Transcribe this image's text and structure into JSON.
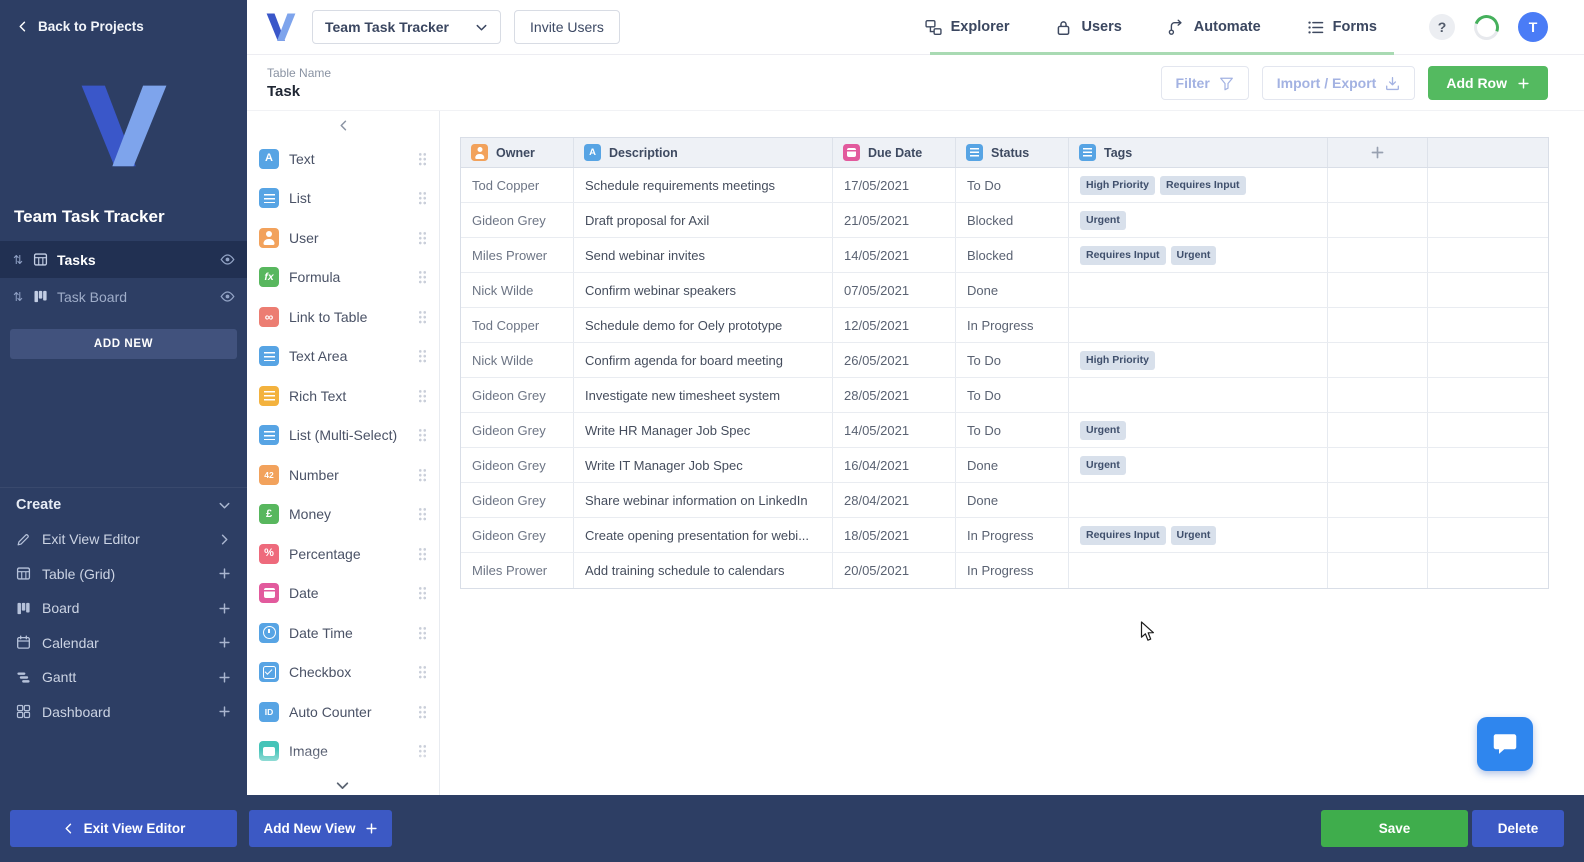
{
  "colors": {
    "sidebar_bg": "#2d3e64",
    "primary_blue": "#3c59c4",
    "save_green": "#3fad4c",
    "add_row_green": "#54ba60",
    "active_tab_underline": "#a9dab3",
    "tag_bg": "#d8e0eb",
    "tag_text": "#3f4f6c",
    "chat_blue": "#2f86ee",
    "avatar_blue": "#4a7cf6"
  },
  "topnav": {
    "workspace_dropdown": "Team Task Tracker",
    "invite_button": "Invite Users",
    "items": [
      {
        "label": "Explorer",
        "icon": "explorer"
      },
      {
        "label": "Users",
        "icon": "lock"
      },
      {
        "label": "Automate",
        "icon": "automate"
      },
      {
        "label": "Forms",
        "icon": "forms"
      }
    ],
    "help_label": "?",
    "avatar_initial": "T"
  },
  "sidebar": {
    "back_label": "Back to Projects",
    "workspace_title": "Team Task Tracker",
    "views": [
      {
        "label": "Tasks",
        "icon": "grid",
        "active": true
      },
      {
        "label": "Task Board",
        "icon": "board",
        "active": false
      }
    ],
    "add_new_label": "ADD NEW",
    "create_header": "Create",
    "create_items": [
      {
        "label": "Exit View Editor",
        "icon": "edit",
        "action": "chev-right"
      },
      {
        "label": "Table (Grid)",
        "icon": "grid",
        "action": "plus"
      },
      {
        "label": "Board",
        "icon": "board",
        "action": "plus"
      },
      {
        "label": "Calendar",
        "icon": "calendar",
        "action": "plus"
      },
      {
        "label": "Gantt",
        "icon": "gantt",
        "action": "plus"
      },
      {
        "label": "Dashboard",
        "icon": "dashboard",
        "action": "plus"
      }
    ]
  },
  "content_header": {
    "table_name_label": "Table Name",
    "table_name_value": "Task",
    "filter_button": "Filter",
    "import_export_button": "Import / Export",
    "add_row_button": "Add Row"
  },
  "field_panel": {
    "items": [
      {
        "label": "Text",
        "icon": "text",
        "glyph": "A",
        "color": "#57a4e4"
      },
      {
        "label": "List",
        "icon": "list",
        "glyph": "",
        "color": "#57a4e4"
      },
      {
        "label": "User",
        "icon": "user",
        "glyph": "",
        "color": "#f2a25c"
      },
      {
        "label": "Formula",
        "icon": "formula",
        "glyph": "fx",
        "color": "#58b75e"
      },
      {
        "label": "Link to Table",
        "icon": "link",
        "glyph": "∞",
        "color": "#ec7d72"
      },
      {
        "label": "Text Area",
        "icon": "textarea",
        "glyph": "",
        "color": "#57a4e4"
      },
      {
        "label": "Rich Text",
        "icon": "richtext",
        "glyph": "",
        "color": "#f3b23e"
      },
      {
        "label": "List (Multi-Select)",
        "icon": "multiselect",
        "glyph": "",
        "color": "#57a4e4"
      },
      {
        "label": "Number",
        "icon": "number",
        "glyph": "42",
        "color": "#f2a25c"
      },
      {
        "label": "Money",
        "icon": "money",
        "glyph": "£",
        "color": "#58b75e"
      },
      {
        "label": "Percentage",
        "icon": "percentage",
        "glyph": "%",
        "color": "#ee6a7c"
      },
      {
        "label": "Date",
        "icon": "date",
        "glyph": "",
        "color": "#e25a9d"
      },
      {
        "label": "Date Time",
        "icon": "clock",
        "glyph": "",
        "color": "#57a4e4"
      },
      {
        "label": "Checkbox",
        "icon": "checkbox",
        "glyph": "",
        "color": "#57a4e4"
      },
      {
        "label": "Auto Counter",
        "icon": "autocounter",
        "glyph": "ID",
        "color": "#57a4e4"
      },
      {
        "label": "Image",
        "icon": "image",
        "glyph": "",
        "color": "#45c4b8"
      }
    ]
  },
  "table": {
    "columns": [
      {
        "label": "Owner",
        "icon": "user",
        "glyph": "",
        "color": "#f2a25c"
      },
      {
        "label": "Description",
        "icon": "text",
        "glyph": "A",
        "color": "#57a4e4"
      },
      {
        "label": "Due Date",
        "icon": "date",
        "glyph": "",
        "color": "#e25a9d"
      },
      {
        "label": "Status",
        "icon": "list",
        "glyph": "",
        "color": "#57a4e4"
      },
      {
        "label": "Tags",
        "icon": "list",
        "glyph": "",
        "color": "#57a4e4"
      }
    ],
    "rows": [
      {
        "owner": "Tod Copper",
        "description": "Schedule requirements meetings",
        "due_date": "17/05/2021",
        "status": "To Do",
        "tags": [
          "High Priority",
          "Requires Input"
        ]
      },
      {
        "owner": "Gideon Grey",
        "description": "Draft proposal for Axil",
        "due_date": "21/05/2021",
        "status": "Blocked",
        "tags": [
          "Urgent"
        ]
      },
      {
        "owner": "Miles Prower",
        "description": "Send webinar invites",
        "due_date": "14/05/2021",
        "status": "Blocked",
        "tags": [
          "Requires Input",
          "Urgent"
        ]
      },
      {
        "owner": "Nick Wilde",
        "description": "Confirm webinar speakers",
        "due_date": "07/05/2021",
        "status": "Done",
        "tags": []
      },
      {
        "owner": "Tod Copper",
        "description": "Schedule demo for Oely prototype",
        "due_date": "12/05/2021",
        "status": "In Progress",
        "tags": []
      },
      {
        "owner": "Nick Wilde",
        "description": "Confirm agenda for board meeting",
        "due_date": "26/05/2021",
        "status": "To Do",
        "tags": [
          "High Priority"
        ]
      },
      {
        "owner": "Gideon Grey",
        "description": "Investigate new timesheet system",
        "due_date": "28/05/2021",
        "status": "To Do",
        "tags": []
      },
      {
        "owner": "Gideon Grey",
        "description": "Write HR Manager Job Spec",
        "due_date": "14/05/2021",
        "status": "To Do",
        "tags": [
          "Urgent"
        ]
      },
      {
        "owner": "Gideon Grey",
        "description": "Write IT Manager Job Spec",
        "due_date": "16/04/2021",
        "status": "Done",
        "tags": [
          "Urgent"
        ]
      },
      {
        "owner": "Gideon Grey",
        "description": "Share webinar information on LinkedIn",
        "due_date": "28/04/2021",
        "status": "Done",
        "tags": []
      },
      {
        "owner": "Gideon Grey",
        "description": "Create opening presentation for webi...",
        "due_date": "18/05/2021",
        "status": "In Progress",
        "tags": [
          "Requires Input",
          "Urgent"
        ]
      },
      {
        "owner": "Miles Prower",
        "description": "Add training schedule to calendars",
        "due_date": "20/05/2021",
        "status": "In Progress",
        "tags": []
      }
    ]
  },
  "footer": {
    "exit_view_editor_button": "Exit View Editor",
    "add_new_view_button": "Add New View",
    "save_button": "Save",
    "delete_button": "Delete"
  }
}
